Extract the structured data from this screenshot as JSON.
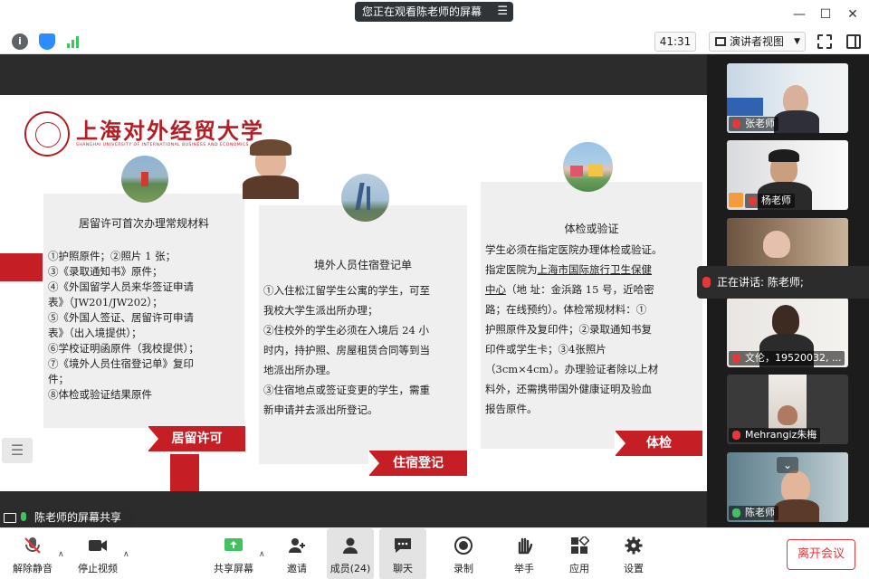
{
  "titlebar": {
    "share_banner": "您正在观看陈老师的屏幕",
    "share_menu_icon": "menu-icon",
    "minimize_icon": "minimize-icon",
    "maximize_icon": "maximize-icon",
    "close_icon": "close-icon"
  },
  "toolbar": {
    "timer": "41:31",
    "view_mode": "演讲者视图",
    "info_icon": "info-icon",
    "security_icon": "shield-icon",
    "signal_icon": "signal-icon",
    "fullscreen_icon": "fullscreen-icon",
    "sidebar_icon": "sidebar-toggle-icon"
  },
  "slide": {
    "university_cn": "上海对外经贸大学",
    "university_en": "SHANGHAI UNIVERSITY OF INTERNATIONAL BUSINESS AND ECONOMICS",
    "card1": {
      "title": "居留许可首次办理常规材料",
      "lines": [
        "①护照原件；②照片 1 张；",
        "③《录取通知书》原件；",
        "④《外国留学人员来华签证申请",
        "表》（JW201/JW202）；",
        "⑤《外国人签证、居留许可申请",
        "表》（出入境提供）；",
        "⑥学校证明函原件（我校提供）；",
        "⑦《境外人员住宿登记单》复印",
        "件；",
        "⑧体检或验证结果原件"
      ],
      "ribbon": "居留许可"
    },
    "card2": {
      "title": "境外人员住宿登记单",
      "lines": [
        "①入住松江留学生公寓的学生，可至",
        "我校大学生派出所办理；",
        "②住校外的学生必须在入境后 24 小",
        "时内，持护照、房屋租赁合同等到当",
        "地派出所办理。",
        "③住宿地点或签证变更的学生，需重",
        "新申请并去派出所登记。"
      ],
      "ribbon": "住宿登记"
    },
    "card3": {
      "title": "体检或验证",
      "line1": "学生必须在指定医院办理体检或验证。",
      "line2_pre": "指定医院为",
      "line2_link": "上海市国际旅行卫生保健",
      "line3_link": "中心",
      "line3_post": "（地 址：金浜路 15 号，近哈密",
      "lines_rest": [
        "路；在线预约）。体检常规材料：①",
        "护照原件及复印件；②录取通知书复",
        "印件或学生卡；③4张照片",
        "（3cm×4cm）。办理验证者除以上材",
        "料外，还需携带国外健康证明及验血",
        "报告原件。"
      ],
      "ribbon": "体检"
    }
  },
  "share_label": "陈老师的屏幕共享",
  "active_speaker": "正在讲话: 陈老师;",
  "participants": [
    {
      "name": "张老师"
    },
    {
      "name": "杨老师"
    },
    {
      "name": ""
    },
    {
      "name": "文伦，19520032, ..."
    },
    {
      "name": "Mehrangiz朱梅"
    },
    {
      "name": "陈老师"
    }
  ],
  "controls": {
    "unmute": "解除静音",
    "stop_video": "停止视频",
    "share_screen": "共享屏幕",
    "invite": "邀请",
    "members": "成员(24)",
    "chat": "聊天",
    "record": "录制",
    "raise_hand": "举手",
    "apps": "应用",
    "settings": "设置",
    "leave": "离开会议"
  },
  "colors": {
    "accent_red": "#c51f25",
    "zoom_green": "#43c060",
    "leave_red": "#e5383b"
  }
}
